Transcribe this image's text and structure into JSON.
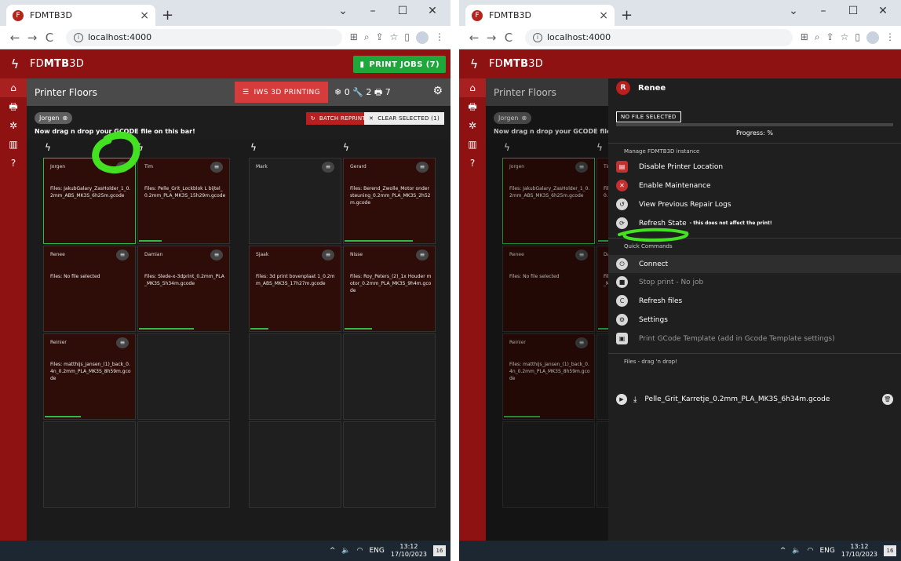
{
  "browser": {
    "tab_title": "FDMTB3D",
    "favicon": "F",
    "url": "localhost:4000",
    "window_controls": [
      "⌄",
      "–",
      "☐",
      "✕"
    ]
  },
  "app": {
    "brand_prefix": "FD",
    "brand_bold": "MTB",
    "brand_suffix": "3D",
    "print_jobs_label": "PRINT JOBS (7)",
    "page_title": "Printer Floors",
    "floor_button": "IWS 3D PRINTING",
    "stats": "❄ 0 🔧 2 🖶 7",
    "filter_chip": "Jorgen",
    "drop_hint": "Now drag n drop your GCODE file on this bar!",
    "batch_reprint": "BATCH REPRINT",
    "clear_selected": "CLEAR SELECTED (1)"
  },
  "printers": [
    {
      "name": "Jorgen",
      "files": "Files: JakubGalary_ZasHolder_1_0.2mm_ABS_MK3S_6h25m.gcode",
      "selected": true,
      "progress": 0
    },
    {
      "name": "Tim",
      "files": "Files: Pelle_Grit_Lockblok L bijtel_0.2mm_PLA_MK3S_15h29m.gcode",
      "selected": false,
      "progress": 0.25
    },
    {
      "name": "Mark",
      "files": "",
      "selected": false,
      "progress": 0,
      "idle": true
    },
    {
      "name": "Gerard",
      "files": "Files: Berend_Zwolle_Motor ondersteuning_0.2mm_PLA_MK3S_2h52m.gcode",
      "selected": false,
      "progress": 0.75
    },
    {
      "name": "Renee",
      "files": "Files: No file selected",
      "selected": false,
      "progress": 0
    },
    {
      "name": "Damian",
      "files": "Files: Slede-x-3dprint_0.2mm_PLA_MK3S_5h34m.gcode",
      "selected": false,
      "progress": 0.6
    },
    {
      "name": "Sjaak",
      "files": "Files: 3d print bovenplaat 1_0.2mm_ABS_MK3S_17h27m.gcode",
      "selected": false,
      "progress": 0.2
    },
    {
      "name": "Nisse",
      "files": "Files: Roy_Peters_(2)_1x Houder motor_0.2mm_PLA_MK3S_9h4m.gcode",
      "selected": false,
      "progress": 0.3
    },
    {
      "name": "Reinier",
      "files": "Files: matthijs_jansen_(1)_back_0.4n_0.2mm_PLA_MK3S_8h59m.gcode",
      "selected": false,
      "progress": 0.4
    }
  ],
  "drawer": {
    "avatar_letter": "R",
    "printer_name": "Renee",
    "no_file": "NO FILE SELECTED",
    "progress_text": "Progress: %",
    "section_manage": "Manage FDMTB3D instance",
    "disable_location": "Disable Printer Location",
    "enable_maintenance": "Enable Maintenance",
    "view_repair_logs": "View Previous Repair Logs",
    "refresh_state": "Refresh State",
    "refresh_note": "- this does not affect the print!",
    "section_quick": "Quick Commands",
    "connect": "Connect",
    "stop_print": "Stop print - No job",
    "refresh_files": "Refresh files",
    "settings": "Settings",
    "print_gcode_template": "Print GCode Template (add in Gcode Template settings)",
    "section_files": "Files - drag 'n drop!",
    "file_name": "Pelle_Grit_Karretje_0.2mm_PLA_MK3S_6h34m.gcode"
  },
  "taskbar": {
    "lang": "ENG",
    "time": "13:12",
    "date": "17/10/2023",
    "notifications": "16"
  },
  "colors": {
    "header": "#8f1212",
    "accent_green": "#1fa83a",
    "highlight_marker": "#44e022"
  }
}
